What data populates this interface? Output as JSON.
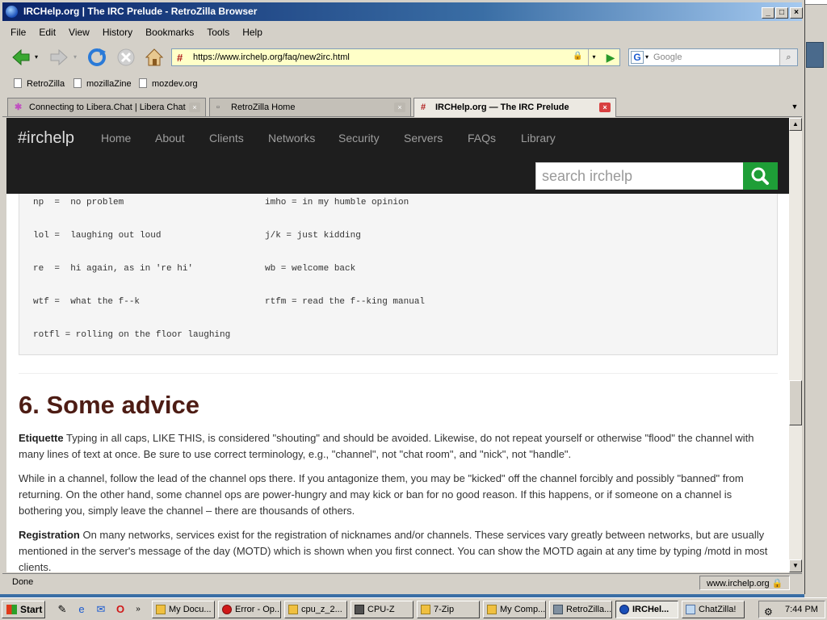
{
  "window": {
    "title": "IRCHelp.org | The IRC Prelude - RetroZilla Browser"
  },
  "menu": [
    "File",
    "Edit",
    "View",
    "History",
    "Bookmarks",
    "Tools",
    "Help"
  ],
  "address": {
    "url": "https://www.irchelp.org/faq/new2irc.html"
  },
  "search": {
    "placeholder": "Google"
  },
  "bookmarks": [
    "RetroZilla",
    "mozillaZine",
    "mozdev.org"
  ],
  "tabs": [
    {
      "label": "Connecting to Libera.Chat | Libera Chat"
    },
    {
      "label": "RetroZilla Home"
    },
    {
      "label": "IRCHelp.org — The IRC Prelude"
    }
  ],
  "site": {
    "logo": "#irchelp",
    "nav": [
      "Home",
      "About",
      "Clients",
      "Networks",
      "Security",
      "Servers",
      "FAQs",
      "Library"
    ],
    "search_placeholder": "search irchelp"
  },
  "acronyms": [
    {
      "left": "np  =  no problem",
      "right": "imho = in my humble opinion"
    },
    {
      "left": "lol =  laughing out loud",
      "right": "j/k = just kidding"
    },
    {
      "left": "re  =  hi again, as in 're hi'",
      "right": "wb = welcome back"
    },
    {
      "left": "wtf =  what the f--k",
      "right": "rtfm = read the f--king manual"
    },
    {
      "left": "rotfl = rolling on the floor laughing",
      "right": ""
    }
  ],
  "section": {
    "heading": "6. Some advice",
    "p1_label": "Etiquette",
    "p1_text": " Typing in all caps, LIKE THIS, is considered \"shouting\" and should be avoided. Likewise, do not repeat yourself or otherwise \"flood\" the channel with many lines of text at once. Be sure to use correct terminology, e.g., \"channel\", not \"chat room\", and \"nick\", not \"handle\".",
    "p2_text": "While in a channel, follow the lead of the channel ops there. If you antagonize them, you may be \"kicked\" off the channel forcibly and possibly \"banned\" from returning. On the other hand, some channel ops are power-hungry and may kick or ban for no good reason. If this happens, or if someone on a channel is bothering you, simply leave the channel – there are thousands of others.",
    "p3_label": "Registration",
    "p3_text": " On many networks, services exist for the registration of nicknames and/or channels. These services vary greatly between networks, but are usually mentioned in the server's message of the day (MOTD) which is shown when you first connect. You can show the MOTD again at any time by typing /motd in most clients."
  },
  "status": {
    "left": "Done",
    "right": "www.irchelp.org"
  },
  "taskbar": {
    "start": "Start",
    "items": [
      "My Docu...",
      "Error - Op...",
      "cpu_z_2...",
      "CPU-Z",
      "7-Zip",
      "My Comp...",
      "RetroZilla...",
      "IRCHel...",
      "ChatZilla!"
    ],
    "clock": "7:44 PM"
  },
  "colors": {
    "accent_green": "#1e9e37",
    "heading": "#4d1c14",
    "navbar": "#1e1e1e"
  }
}
